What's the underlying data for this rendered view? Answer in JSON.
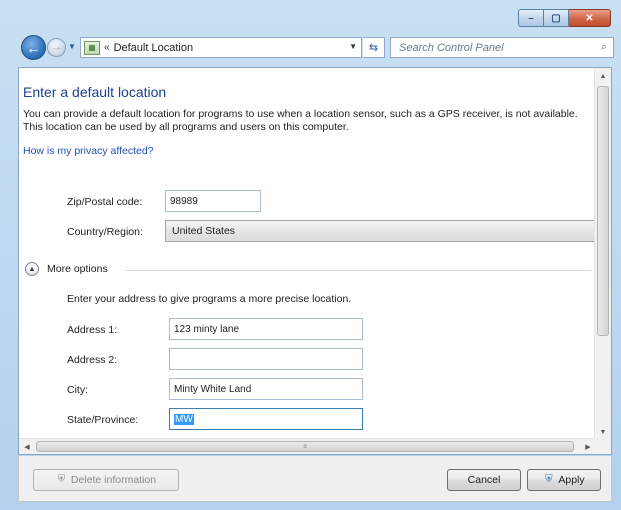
{
  "window": {
    "controls": {
      "minimize": "–",
      "maximize": "▢",
      "close": "✕"
    }
  },
  "nav": {
    "breadcrumb_prefix": "«",
    "address": "Default Location",
    "search_placeholder": "Search Control Panel"
  },
  "page": {
    "title": "Enter a default location",
    "intro": "You can provide a default location for programs to use when a location sensor, such as a GPS receiver, is not available. This location can be used by all programs and users on this computer.",
    "privacy_link": "How is my privacy affected?"
  },
  "form": {
    "zip_label": "Zip/Postal code:",
    "zip_value": "98989",
    "country_label": "Country/Region:",
    "country_value": "United States",
    "more_options_label": "More options",
    "address_hint": "Enter your address to give programs a more precise location.",
    "address1_label": "Address 1:",
    "address1_value": "123 minty lane",
    "address2_label": "Address 2:",
    "address2_value": "",
    "city_label": "City:",
    "city_value": "Minty White Land",
    "state_label": "State/Province:",
    "state_value": "MW"
  },
  "footer": {
    "delete_label": "Delete information",
    "cancel_label": "Cancel",
    "apply_label": "Apply"
  },
  "colors": {
    "link": "#1f4fb5",
    "title": "#1e3f8f",
    "selection": "#3399ff"
  }
}
